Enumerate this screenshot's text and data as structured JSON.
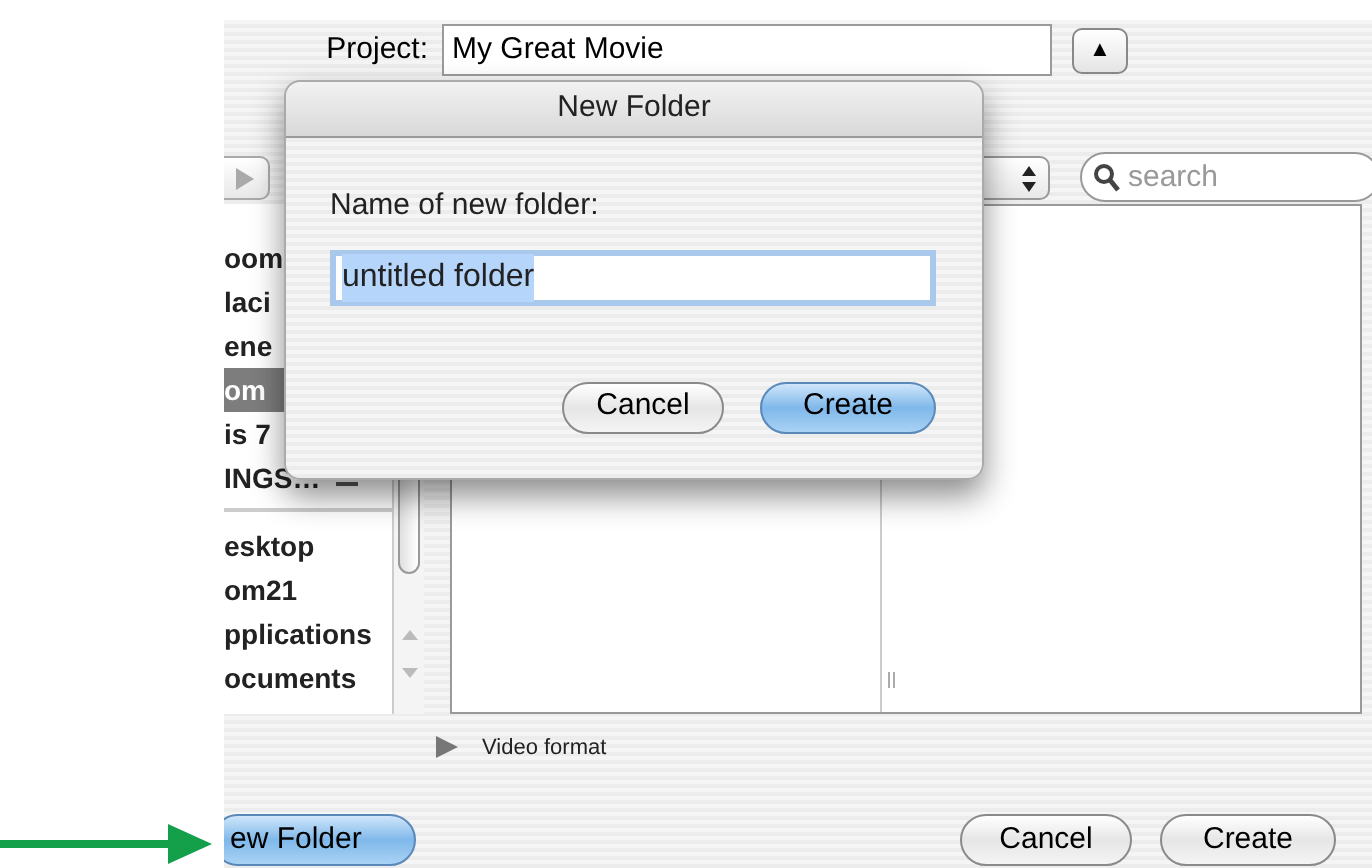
{
  "project": {
    "label": "Project:",
    "value": "My Great Movie",
    "toggle": "▲"
  },
  "search": {
    "placeholder": "search"
  },
  "sidebar": {
    "groups": [
      {
        "items": [
          {
            "label": "oom",
            "selected": false,
            "ejectable": false
          },
          {
            "label": "laci",
            "selected": false,
            "ejectable": false
          },
          {
            "label": "ene",
            "selected": false,
            "ejectable": false
          },
          {
            "label": "om",
            "selected": true,
            "ejectable": false
          },
          {
            "label": "is 7",
            "selected": false,
            "ejectable": false
          },
          {
            "label": "INGS…",
            "selected": false,
            "ejectable": true
          }
        ]
      },
      {
        "items": [
          {
            "label": "esktop",
            "selected": false,
            "ejectable": false
          },
          {
            "label": "om21",
            "selected": false,
            "ejectable": false
          },
          {
            "label": "pplications",
            "selected": false,
            "ejectable": false
          },
          {
            "label": "ocuments",
            "selected": false,
            "ejectable": false
          }
        ]
      }
    ]
  },
  "disclosure": {
    "label": "Video format",
    "expanded": false
  },
  "buttons": [
    {
      "label": "ew Folder",
      "default": true
    },
    {
      "label": "Cancel",
      "default": false
    },
    {
      "label": "Create",
      "default": false
    }
  ],
  "dialog": {
    "title": "New Folder",
    "label": "Name of new folder:",
    "value": "untitled folder",
    "value_selected": true,
    "buttons": [
      {
        "label": "Cancel",
        "default": false
      },
      {
        "label": "Create",
        "default": true
      }
    ]
  }
}
